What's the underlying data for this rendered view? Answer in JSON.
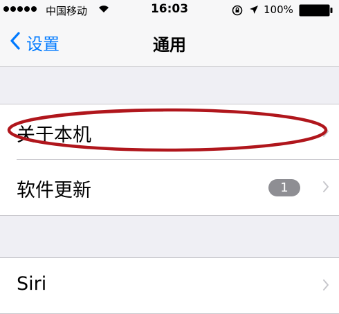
{
  "status_bar": {
    "carrier": "中国移动",
    "time": "16:03",
    "battery": "100%",
    "icons": [
      "signal-dots-icon",
      "wifi-icon",
      "rotation-lock-icon",
      "location-arrow-icon",
      "battery-icon"
    ]
  },
  "nav": {
    "back_label": "设置",
    "title": "通用",
    "back_icon": "chevron-left-icon"
  },
  "rows": {
    "about": {
      "label": "关于本机"
    },
    "software_update": {
      "label": "软件更新",
      "badge": "1"
    },
    "siri": {
      "label": "Siri"
    }
  },
  "colors": {
    "accent": "#007aff",
    "badge": "#8e8e93",
    "annotation": "#b0161c",
    "background": "#efeff4"
  }
}
